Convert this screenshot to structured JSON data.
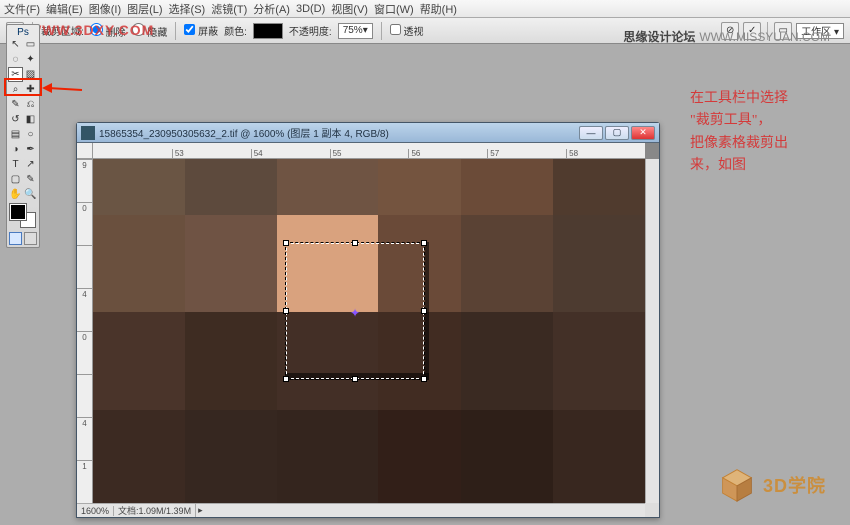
{
  "menu": {
    "items": [
      "文件(F)",
      "编辑(E)",
      "图像(I)",
      "图层(L)",
      "选择(S)",
      "滤镜(T)",
      "分析(A)",
      "3D(D)",
      "视图(V)",
      "窗口(W)",
      "帮助(H)"
    ]
  },
  "options": {
    "label_crop_area": "裁剪区域:",
    "btn_delete": "删除",
    "btn_hide": "隐藏",
    "label_crop_guide": "屏蔽",
    "label_color": "颜色:",
    "label_opacity": "不透明度:",
    "opacity_value": "75%",
    "check_perspective": "透视",
    "workspace_label": "工作区 ▾"
  },
  "watermarks": {
    "left": "WWW.3DXY.COM",
    "right_cn": "思缘设计论坛",
    "right_url": "WWW.MISSYUAN.COM"
  },
  "document": {
    "title": "15865354_230950305632_2.tif @ 1600% (图层 1 副本 4, RGB/8)",
    "ruler_h": [
      "",
      "53",
      "54",
      "55",
      "56",
      "57",
      "58"
    ],
    "ruler_v": [
      "9",
      "0",
      "",
      "4",
      "0",
      "",
      "4",
      "1"
    ],
    "zoom": "1600%",
    "status": "文档:1.09M/1.39M"
  },
  "pixels": [
    [
      "#6a5544",
      "#5d4a3d",
      "#6f5443",
      "#74543f",
      "#6b4b38",
      "#503b2e"
    ],
    [
      "#6a503e",
      "#6f5344",
      "#d9a27e",
      "#6a4a38",
      "#5a4234",
      "#4d3b30"
    ],
    [
      "#4a342a",
      "#3e2c22",
      "#432f26",
      "#412c22",
      "#3a2a22",
      "#433027"
    ],
    [
      "#3c2a22",
      "#362720",
      "#34251e",
      "#321f18",
      "#2e1f18",
      "#38271f"
    ]
  ],
  "annotation": {
    "line1": "在工具栏中选择",
    "line2": "\"裁剪工具\"，",
    "line3": "把像素格裁剪出",
    "line4": "来，如图"
  },
  "logo": {
    "text": "3D学院"
  },
  "tools": {
    "names": [
      [
        "move-tool",
        "marquee-tool"
      ],
      [
        "lasso-tool",
        "magic-wand-tool"
      ],
      [
        "crop-tool",
        "slice-tool"
      ],
      [
        "eyedropper-tool",
        "healing-brush-tool"
      ],
      [
        "brush-tool",
        "clone-stamp-tool"
      ],
      [
        "history-brush-tool",
        "eraser-tool"
      ],
      [
        "gradient-tool",
        "blur-tool"
      ],
      [
        "dodge-tool",
        "pen-tool"
      ],
      [
        "type-tool",
        "path-selection-tool"
      ],
      [
        "rectangle-tool",
        "notes-tool"
      ],
      [
        "hand-tool",
        "zoom-tool"
      ]
    ],
    "glyphs": [
      [
        "↖",
        "▭"
      ],
      [
        "◌",
        "✦"
      ],
      [
        "✂",
        "▨"
      ],
      [
        "⌕",
        "✚"
      ],
      [
        "✎",
        "⎌"
      ],
      [
        "↺",
        "◧"
      ],
      [
        "▤",
        "○"
      ],
      [
        "◑",
        "✒"
      ],
      [
        "T",
        "↗"
      ],
      [
        "▢",
        "✎"
      ],
      [
        "✋",
        "🔍"
      ]
    ]
  }
}
